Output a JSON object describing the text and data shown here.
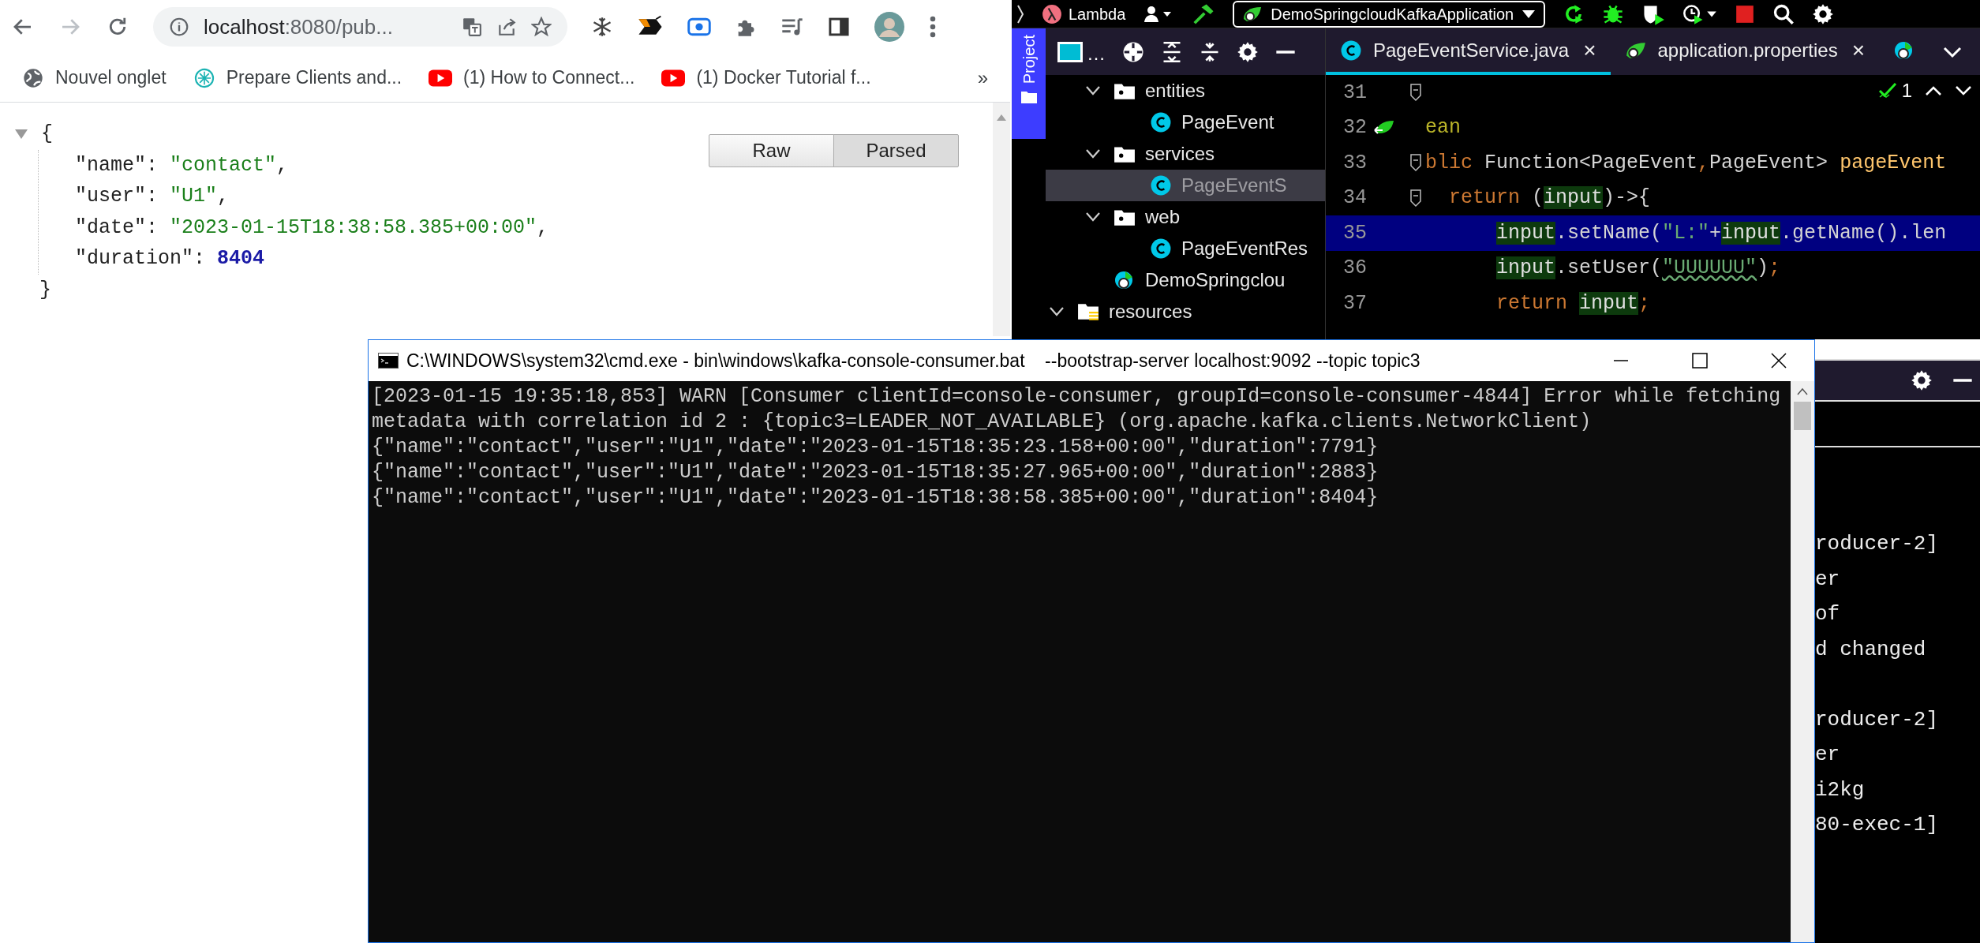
{
  "browser": {
    "address": {
      "host": "localhost",
      "rest": ":8080/pub..."
    },
    "bookmarks": [
      {
        "label": "Nouvel onglet",
        "kind": "globe"
      },
      {
        "label": "Prepare Clients and...",
        "kind": "site"
      },
      {
        "label": "(1) How to Connect...",
        "kind": "youtube"
      },
      {
        "label": "(1) Docker Tutorial f...",
        "kind": "youtube"
      }
    ],
    "bookmarks_more": "»",
    "view_toggle": [
      {
        "label": "Raw",
        "selected": false
      },
      {
        "label": "Parsed",
        "selected": true
      }
    ],
    "json_open": "{",
    "json_fields": [
      {
        "key": "\"name\":",
        "value": "\"contact\"",
        "kind": "string",
        "separator": ","
      },
      {
        "key": "\"user\":",
        "value": "\"U1\"",
        "kind": "string",
        "separator": ","
      },
      {
        "key": "\"date\":",
        "value": "\"2023-01-15T18:38:58.385+00:00\"",
        "kind": "string",
        "separator": ","
      },
      {
        "key": "\"duration\":",
        "value": "8404",
        "kind": "number"
      }
    ],
    "json_close": "}"
  },
  "ide": {
    "project_name": "Lambda",
    "run_config": "DemoSpringcloudKafkaApplication",
    "tool_strip": [
      {
        "label": "Project",
        "selected": true
      }
    ],
    "project_header_ellipsis": "…",
    "tree": [
      {
        "children": [
          {
            "label": "entities",
            "kind": "folder",
            "expanded": true,
            "selected": false,
            "children": [
              {
                "label": "PageEvent",
                "kind": "class",
                "selected": false
              }
            ]
          },
          {
            "label": "services",
            "kind": "folder",
            "expanded": true,
            "selected": false,
            "children": [
              {
                "label": "PageEventS",
                "kind": "class",
                "selected": true
              }
            ]
          },
          {
            "label": "web",
            "kind": "folder",
            "expanded": true,
            "selected": false,
            "children": [
              {
                "label": "PageEventRes",
                "kind": "class",
                "selected": false
              }
            ]
          },
          {
            "label": "DemoSpringclou",
            "kind": "app",
            "selected": false
          }
        ]
      },
      {
        "label": "resources",
        "kind": "resources",
        "expanded": true,
        "selected": false
      }
    ],
    "tabs": [
      {
        "label": "PageEventService.java",
        "kind": "class",
        "selected": true,
        "close": "×"
      },
      {
        "label": "application.properties",
        "kind": "spring",
        "selected": false,
        "close": "×"
      },
      {
        "kind": "app",
        "selected": false
      }
    ],
    "problems_count": "1",
    "code_lines": [
      {
        "number": "31",
        "current": false,
        "fold": true,
        "bean_marker": false
      },
      {
        "number": "32",
        "current": false,
        "fold": false,
        "bean_marker": true,
        "tokens": [
          {
            "t": "ean",
            "kind": "annotation"
          }
        ]
      },
      {
        "number": "33",
        "current": false,
        "fold": true,
        "bean_marker": false,
        "tokens": [
          {
            "t": "blic",
            "kind": "keyword"
          },
          {
            "t": " Function<PageEvent",
            "kind": "plain"
          },
          {
            "t": ",",
            "kind": "punct"
          },
          {
            "t": "PageEvent> ",
            "kind": "plain"
          },
          {
            "t": "pageEvent",
            "kind": "method"
          }
        ]
      },
      {
        "number": "34",
        "current": false,
        "fold": true,
        "bean_marker": false,
        "tokens": [
          {
            "t": "  return",
            "kind": "keyword"
          },
          {
            "t": " (",
            "kind": "plain"
          },
          {
            "t": "input",
            "kind": "ref"
          },
          {
            "t": ")->{",
            "kind": "plain"
          }
        ]
      },
      {
        "number": "35",
        "current": true,
        "fold": false,
        "bean_marker": false,
        "tokens": [
          {
            "t": "      input",
            "kind": "ref"
          },
          {
            "t": ".setName(",
            "kind": "plain"
          },
          {
            "t": "\"L:\"",
            "kind": "string"
          },
          {
            "t": "+",
            "kind": "plain"
          },
          {
            "t": "input",
            "kind": "ref"
          },
          {
            "t": ".getName().len",
            "kind": "plain"
          }
        ]
      },
      {
        "number": "36",
        "current": false,
        "fold": false,
        "bean_marker": false,
        "tokens": [
          {
            "t": "      input",
            "kind": "ref"
          },
          {
            "t": ".setUser(",
            "kind": "plain"
          },
          {
            "t": "\"UUUUUU\"",
            "kind": "typo"
          },
          {
            "t": ")",
            "kind": "plain"
          },
          {
            "t": ";",
            "kind": "punct"
          }
        ]
      },
      {
        "number": "37",
        "current": false,
        "fold": false,
        "bean_marker": false,
        "tokens": [
          {
            "t": "      return",
            "kind": "keyword"
          },
          {
            "t": " input",
            "kind": "ref"
          },
          {
            "t": ";",
            "kind": "punct"
          }
        ]
      }
    ],
    "run_output": [
      [
        "roducer-2]",
        "er",
        "of",
        "d changed"
      ],
      [
        "roducer-2]",
        "er",
        "i2kg",
        "80-exec-1]"
      ]
    ]
  },
  "console": {
    "title": "C:\\WINDOWS\\system32\\cmd.exe - bin\\windows\\kafka-console-consumer.bat    --bootstrap-server localhost:9092 --topic topic3",
    "lines": [
      "[2023-01-15 19:35:18,853] WARN [Consumer clientId=console-consumer, groupId=console-consumer-4844] Error while fetching",
      "metadata with correlation id 2 : {topic3=LEADER_NOT_AVAILABLE} (org.apache.kafka.clients.NetworkClient)",
      "{\"name\":\"contact\",\"user\":\"U1\",\"date\":\"2023-01-15T18:35:23.158+00:00\",\"duration\":7791}",
      "{\"name\":\"contact\",\"user\":\"U1\",\"date\":\"2023-01-15T18:35:27.965+00:00\",\"duration\":2883}",
      "{\"name\":\"contact\",\"user\":\"U1\",\"date\":\"2023-01-15T18:38:58.385+00:00\",\"duration\":8404}"
    ]
  }
}
